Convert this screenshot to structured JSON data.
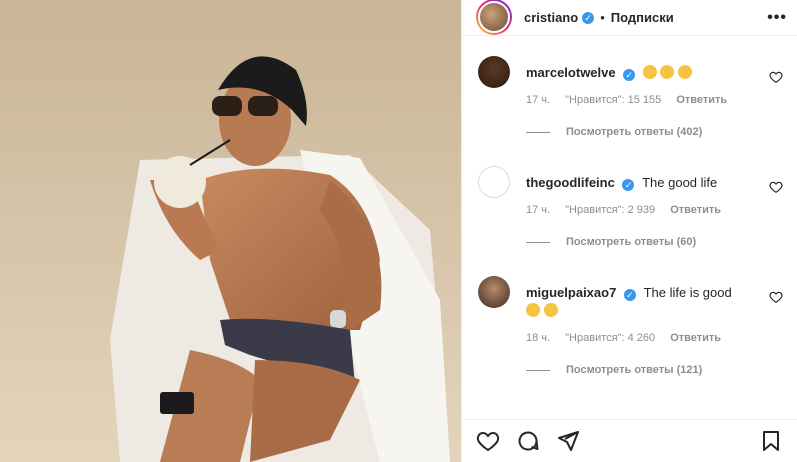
{
  "header": {
    "username": "cristiano",
    "separator": "•",
    "follow_label": "Подписки",
    "more_label": "•••"
  },
  "comments": [
    {
      "username": "marcelotwelve",
      "text": "",
      "emojis": [
        "laughing-emoji",
        "laughing-emoji",
        "laughing-emoji"
      ],
      "time": "17 ч.",
      "likes": "\"Нравится\": 15 155",
      "reply_label": "Ответить",
      "view_replies": "Посмотреть ответы (402)"
    },
    {
      "username": "thegoodlifeinc",
      "text": "The good life",
      "emojis": [],
      "time": "17 ч.",
      "likes": "\"Нравится\": 2 939",
      "reply_label": "Ответить",
      "view_replies": "Посмотреть ответы (60)"
    },
    {
      "username": "miguelpaixao7",
      "text": "The life is good",
      "emojis": [
        "sunglasses-emoji",
        "grinning-sweat-emoji"
      ],
      "time": "18 ч.",
      "likes": "\"Нравится\": 4 260",
      "reply_label": "Ответить",
      "view_replies": "Посмотреть ответы (121)"
    }
  ],
  "actions": [
    "heart-icon",
    "comment-icon",
    "share-icon",
    "bookmark-icon"
  ],
  "colors": {
    "verified": "#3897f0",
    "secondary_text": "#8e8e8e",
    "border": "#efefef"
  }
}
